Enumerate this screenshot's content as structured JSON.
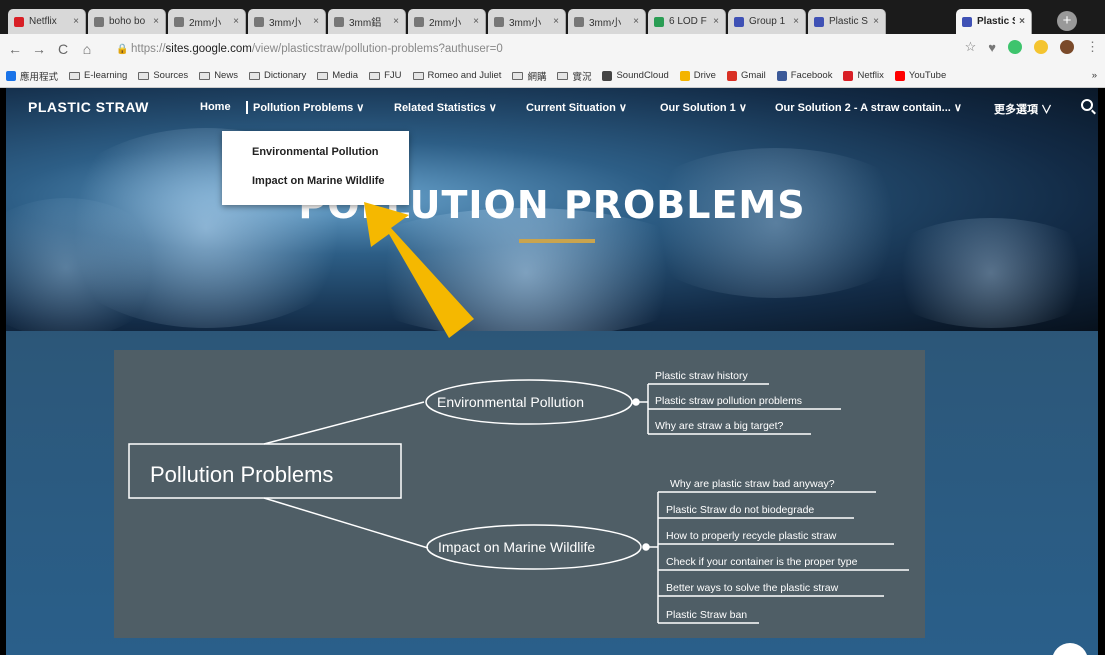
{
  "browser": {
    "tabs": [
      {
        "title": "Netflix",
        "color": "#d81f26"
      },
      {
        "title": "boho bo",
        "color": "#777777"
      },
      {
        "title": "2mm小",
        "color": "#777777"
      },
      {
        "title": "3mm小",
        "color": "#777777"
      },
      {
        "title": "3mm鋁",
        "color": "#777777"
      },
      {
        "title": "2mm小",
        "color": "#777777"
      },
      {
        "title": "3mm小",
        "color": "#777777"
      },
      {
        "title": "3mm小",
        "color": "#777777"
      },
      {
        "title": "6 LOD F",
        "color": "#2a9d54"
      },
      {
        "title": "Group 1",
        "color": "#3f51b5"
      },
      {
        "title": "Plastic S",
        "color": "#3f51b5"
      },
      {
        "title": "Plastic S",
        "color": "#3f51b5",
        "active": true
      }
    ],
    "url_prefix": "https://",
    "url_host": "sites.google.com",
    "url_path": "/view/plasticstraw/pollution-problems?authuser=0",
    "bookmarks": [
      {
        "label": "應用程式",
        "kind": "apps"
      },
      {
        "label": "E-learning",
        "kind": "folder"
      },
      {
        "label": "Sources",
        "kind": "folder"
      },
      {
        "label": "News",
        "kind": "folder"
      },
      {
        "label": "Dictionary",
        "kind": "folder"
      },
      {
        "label": "Media",
        "kind": "folder"
      },
      {
        "label": "FJU",
        "kind": "folder"
      },
      {
        "label": "Romeo and Juliet",
        "kind": "folder"
      },
      {
        "label": "網購",
        "kind": "folder"
      },
      {
        "label": "實況",
        "kind": "folder"
      },
      {
        "label": "SoundCloud",
        "kind": "site",
        "color": "#444444"
      },
      {
        "label": "Drive",
        "kind": "site",
        "color": "#f4b400"
      },
      {
        "label": "Gmail",
        "kind": "site",
        "color": "#d93025"
      },
      {
        "label": "Facebook",
        "kind": "site",
        "color": "#3b5998"
      },
      {
        "label": "Netflix",
        "kind": "site",
        "color": "#d81f26"
      },
      {
        "label": "YouTube",
        "kind": "site",
        "color": "#ff0000"
      }
    ],
    "bookmarks_more": "»"
  },
  "site": {
    "logo": "PLASTIC STRAW",
    "nav": {
      "home": "Home",
      "pollution": "Pollution Problems ∨",
      "stats": "Related Statistics ∨",
      "current": "Current Situation ∨",
      "solution1": "Our Solution 1 ∨",
      "solution2": "Our Solution 2 - A straw contain... ∨",
      "more": "更多選項 ∨"
    },
    "dropdown": {
      "item1": "Environmental Pollution",
      "item2": "Impact on Marine Wildlife"
    },
    "hero_title": "POLLUTION PROBLEMS",
    "accent_color": "#c9a44e",
    "arrow_color": "#f5b800"
  },
  "mindmap": {
    "root": "Pollution Problems",
    "branch1": {
      "label": "Environmental Pollution",
      "leaves": [
        "Plastic straw history",
        "Plastic straw pollution problems",
        "Why are straw a big target?"
      ]
    },
    "branch2": {
      "label": "Impact on Marine Wildlife",
      "leaves": [
        "Why are plastic straw bad anyway?",
        "Plastic Straw do not biodegrade",
        "How to properly recycle plastic straw",
        "Check if your container is the proper type",
        "Better ways to solve the plastic straw",
        "Plastic Straw ban"
      ]
    }
  }
}
